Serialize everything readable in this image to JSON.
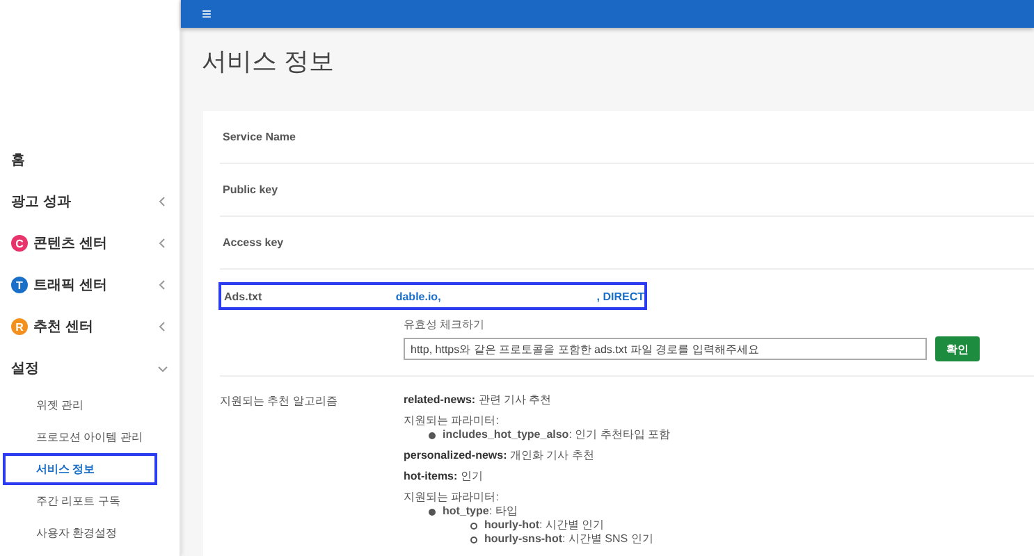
{
  "sidebar": {
    "items": [
      {
        "label": "홈"
      },
      {
        "label": "광고 성과",
        "expanded": false
      },
      {
        "label": "콘텐츠 센터",
        "badge": "C",
        "color": "#e8336b",
        "expanded": false
      },
      {
        "label": "트래픽 센터",
        "badge": "T",
        "color": "#1a6fc9",
        "expanded": false
      },
      {
        "label": "추천 센터",
        "badge": "R",
        "color": "#f4901e",
        "expanded": false
      },
      {
        "label": "설정",
        "expanded": true,
        "children": [
          {
            "label": "위젯 관리",
            "selected": false
          },
          {
            "label": "프로모션 아이템 관리",
            "selected": false
          },
          {
            "label": "서비스 정보",
            "selected": true
          },
          {
            "label": "주간 리포트 구독",
            "selected": false
          },
          {
            "label": "사용자 환경설정",
            "selected": false
          }
        ]
      }
    ]
  },
  "topbar": {
    "menu_icon": "≡"
  },
  "page_title": "서비스 정보",
  "info_rows": [
    {
      "label": "Service Name"
    },
    {
      "label": "Public key"
    },
    {
      "label": "Access key"
    },
    {
      "label": "Ads.txt",
      "value_start": "dable.io,",
      "value_end": ", DIRECT",
      "highlighted": true
    }
  ],
  "validity": {
    "label": "유효성 체크하기",
    "placeholder": "http, https와 같은 프로토콜을 포함한 ads.txt 파일 경로를 입력해주세요",
    "button": "확인"
  },
  "algorithms": {
    "label": "지원되는 추천 알고리즘",
    "items": [
      {
        "name": "related-news:",
        "desc": " 관련 기사 추천",
        "params": {
          "label": "지원되는 파라미터:",
          "items": [
            {
              "name": "includes_hot_type_also",
              "desc": ": 인기 추천타입 포함"
            }
          ]
        }
      },
      {
        "name": "personalized-news:",
        "desc": " 개인화 기사 추천"
      },
      {
        "name": "hot-items:",
        "desc": " 인기",
        "params": {
          "label": "지원되는 파라미터:",
          "items": [
            {
              "name": "hot_type",
              "desc": ": 타입",
              "children": [
                {
                  "name": "hourly-hot",
                  "desc": ": 시간별 인기"
                },
                {
                  "name": "hourly-sns-hot",
                  "desc": ": 시간별 SNS 인기"
                }
              ]
            }
          ]
        }
      }
    ]
  }
}
